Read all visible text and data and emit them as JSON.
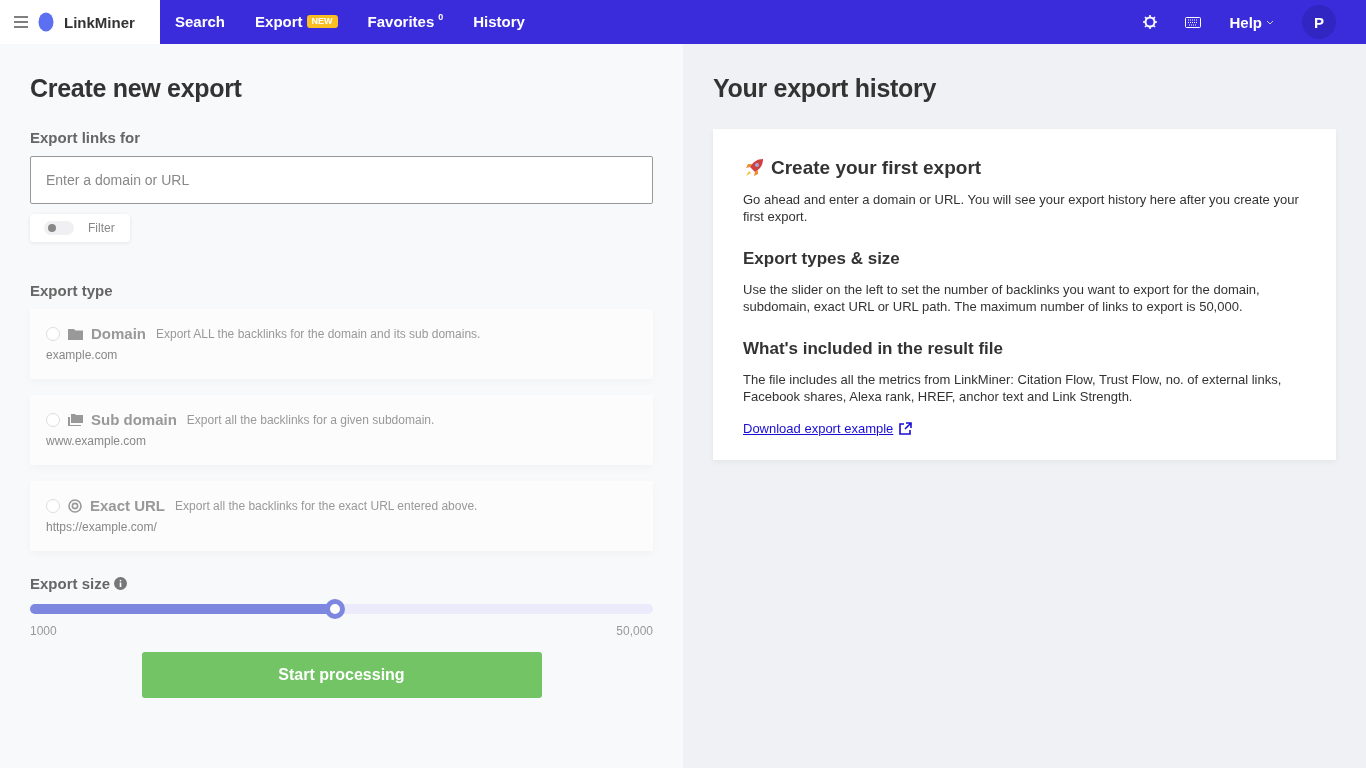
{
  "brand": {
    "name": "LinkMiner"
  },
  "nav": [
    {
      "label": "Search",
      "selected": false
    },
    {
      "label": "Export",
      "badge": "NEW",
      "selected": false
    },
    {
      "label": "Favorites",
      "count": "0",
      "selected": false
    },
    {
      "label": "History",
      "selected": false
    }
  ],
  "help": {
    "label": "Help"
  },
  "avatar": {
    "initial": "P"
  },
  "form": {
    "title": "Create new export",
    "links_label": "Export links for",
    "input": {
      "placeholder": "Enter a domain or URL"
    },
    "filter": {
      "label": "Filter",
      "on": false
    },
    "type_label": "Export type",
    "types": [
      {
        "kind": "folder",
        "name": "Domain",
        "description": "Export ALL the backlinks for the domain and its sub domains.",
        "example": "example.com",
        "selected": false
      },
      {
        "kind": "folders",
        "name": "Sub domain",
        "description": "Export all the backlinks for a given subdomain.",
        "example": "www.example.com",
        "selected": false
      },
      {
        "kind": "target",
        "name": "Exact URL",
        "description": "Export all the backlinks for the exact URL entered above.",
        "example": "https://example.com/",
        "selected": false
      }
    ],
    "size": {
      "label": "Export size",
      "level": 0.49,
      "min": "1000",
      "max": "50,000"
    },
    "submit": "Start processing"
  },
  "history": {
    "title": "Your export history",
    "sections": [
      {
        "kind": "intro",
        "heading": "Create your first export",
        "text": "Go ahead and enter a domain or URL. You will see your export history here after you create your first export."
      },
      {
        "kind": "plain",
        "heading": "Export types & size",
        "text": "Use the slider on the left to set the number of backlinks you want to export for the domain, subdomain, exact URL or URL path. The maximum number of links to export is 50,000."
      },
      {
        "kind": "plain",
        "heading": "What's included in the result file",
        "text": "The file includes all the metrics from LinkMiner: Citation Flow, Trust Flow,  no. of external links, Facebook shares, Alexa rank, HREF, anchor text and Link Strength."
      }
    ],
    "link": "Download export example"
  }
}
